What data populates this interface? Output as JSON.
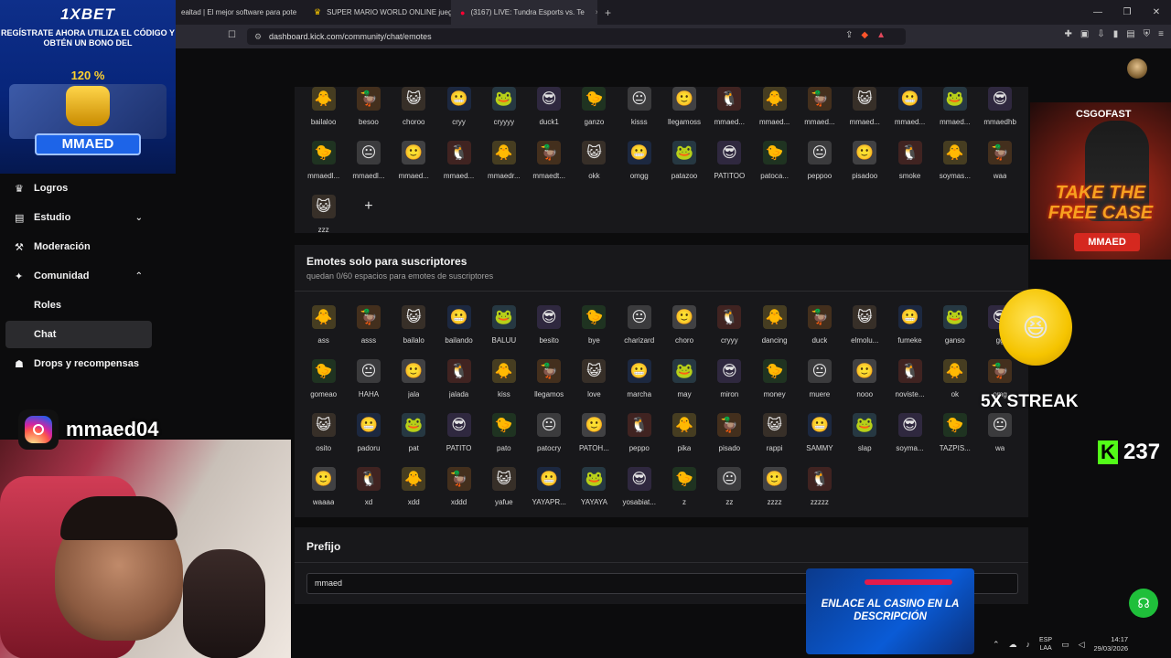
{
  "browser": {
    "tabs": [
      {
        "icon": "",
        "title": "ealtad | El mejor software para pote"
      },
      {
        "icon": "♛",
        "title": "SUPER MARIO WORLD ONLINE juego"
      },
      {
        "icon": "●",
        "title": "(3167) LIVE: Tundra Esports vs. Te"
      }
    ],
    "url": "dashboard.kick.com/community/chat/emotes"
  },
  "nav": [
    {
      "label": "Logros",
      "icon": "♛"
    },
    {
      "label": "Estudio",
      "icon": "▤"
    },
    {
      "label": "Moderación",
      "icon": "⚒"
    },
    {
      "label": "Comunidad",
      "icon": "✦"
    },
    {
      "label": "Roles",
      "icon": ""
    },
    {
      "label": "Chat",
      "icon": ""
    },
    {
      "label": "Drops y recompensas",
      "icon": "☗"
    }
  ],
  "emotes_top": [
    "bailaloo",
    "besoo",
    "choroo",
    "cryy",
    "cryyyy",
    "duck1",
    "ganzo",
    "kisss",
    "llegamoss",
    "mmaed...",
    "mmaed...",
    "mmaed...",
    "mmaed...",
    "mmaed...",
    "mmaed...",
    "mmaedhb",
    "mmaedl...",
    "mmaedl...",
    "mmaed...",
    "mmaed...",
    "mmaedr...",
    "mmaedt...",
    "okk",
    "omgg",
    "patazoo",
    "PATITOO",
    "patoca...",
    "peppoo",
    "pisadoo",
    "smoke",
    "soymas...",
    "waa",
    "zzz"
  ],
  "sub_section": {
    "title": "Emotes solo para suscriptores",
    "subtitle": "quedan 0/60 espacios para emotes de suscriptores"
  },
  "emotes_sub": [
    "ass",
    "asss",
    "bailalo",
    "bailando",
    "BALUU",
    "besito",
    "bye",
    "charizard",
    "choro",
    "cryyy",
    "dancing",
    "duck",
    "elmolu...",
    "fumeke",
    "ganso",
    "gg",
    "gomeao",
    "HAHA",
    "jala",
    "jalada",
    "kiss",
    "llegamos",
    "love",
    "marcha",
    "may",
    "miron",
    "money",
    "muere",
    "nooo",
    "noviste...",
    "ok",
    "omg",
    "osito",
    "padoru",
    "pat",
    "PATITO",
    "pato",
    "patocry",
    "PATOH...",
    "peppo",
    "pika",
    "pisado",
    "rappi",
    "SAMMY",
    "slap",
    "soyma...",
    "TAZPIS...",
    "wa",
    "waaaa",
    "xd",
    "xdd",
    "xddd",
    "yafue",
    "YAYAPR...",
    "YAYAYA",
    "yosabiat...",
    "z",
    "zz",
    "zzzz",
    "zzzzz"
  ],
  "prefix": {
    "title": "Prefijo",
    "value": "mmaed"
  },
  "overlays": {
    "ad_1xbet": {
      "logo": "1XBET",
      "text": "REGÍSTRATE AHORA UTILIZA EL CÓDIGO Y OBTÉN UN BONO DEL",
      "percent": "120 %",
      "code": "MMAED"
    },
    "instagram": "mmaed04",
    "csgofast": {
      "logo": "CSGOFAST",
      "text": "TAKE THE FREE CASE",
      "code": "MMAED"
    },
    "streak": "5X STREAK",
    "viewers": "237",
    "casino": "ENLACE AL CASINO EN LA DESCRIPCIÓN"
  },
  "taskbar": {
    "lang_1": "ESP",
    "lang_2": "LAA",
    "time": "14:17",
    "date": "29/03/2026"
  },
  "colors": {
    "accent": "#53fc18",
    "panel": "#18181b",
    "page": "#0c0c0d"
  }
}
